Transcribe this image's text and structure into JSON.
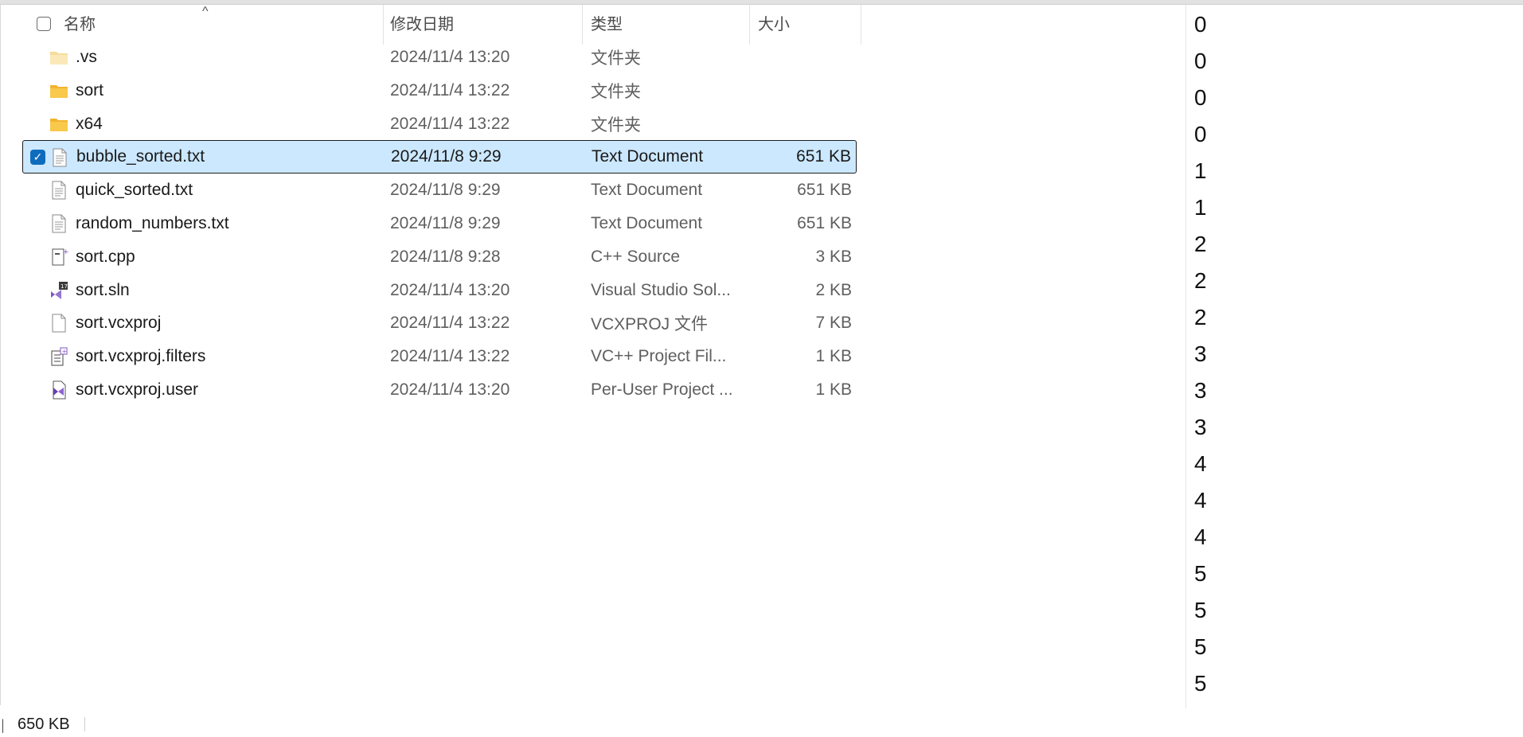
{
  "explorer": {
    "columns": {
      "name": "名称",
      "date": "修改日期",
      "type": "类型",
      "size": "大小"
    },
    "sort_indicator": "^",
    "rows": [
      {
        "name": ".vs",
        "date": "2024/11/4 13:20",
        "type": "文件夹",
        "size": "",
        "icon": "folder-light-icon",
        "selected": false
      },
      {
        "name": "sort",
        "date": "2024/11/4 13:22",
        "type": "文件夹",
        "size": "",
        "icon": "folder-icon",
        "selected": false
      },
      {
        "name": "x64",
        "date": "2024/11/4 13:22",
        "type": "文件夹",
        "size": "",
        "icon": "folder-icon",
        "selected": false
      },
      {
        "name": "bubble_sorted.txt",
        "date": "2024/11/8 9:29",
        "type": "Text Document",
        "size": "651 KB",
        "icon": "text-document-icon",
        "selected": true
      },
      {
        "name": "quick_sorted.txt",
        "date": "2024/11/8 9:29",
        "type": "Text Document",
        "size": "651 KB",
        "icon": "text-document-icon",
        "selected": false
      },
      {
        "name": "random_numbers.txt",
        "date": "2024/11/8 9:29",
        "type": "Text Document",
        "size": "651 KB",
        "icon": "text-document-icon",
        "selected": false
      },
      {
        "name": "sort.cpp",
        "date": "2024/11/8 9:28",
        "type": "C++ Source",
        "size": "3 KB",
        "icon": "cpp-source-icon",
        "selected": false
      },
      {
        "name": "sort.sln",
        "date": "2024/11/4 13:20",
        "type": "Visual Studio Sol...",
        "size": "2 KB",
        "icon": "visual-studio-solution-icon",
        "selected": false
      },
      {
        "name": "sort.vcxproj",
        "date": "2024/11/4 13:22",
        "type": "VCXPROJ 文件",
        "size": "7 KB",
        "icon": "blank-file-icon",
        "selected": false
      },
      {
        "name": "sort.vcxproj.filters",
        "date": "2024/11/4 13:22",
        "type": "VC++ Project Fil...",
        "size": "1 KB",
        "icon": "project-filters-icon",
        "selected": false
      },
      {
        "name": "sort.vcxproj.user",
        "date": "2024/11/4 13:20",
        "type": "Per-User Project ...",
        "size": "1 KB",
        "icon": "vs-user-file-icon",
        "selected": false
      }
    ]
  },
  "status_bar": {
    "fragment": "目",
    "size": "650 KB"
  },
  "text_pane": {
    "numbers": [
      "0",
      "0",
      "0",
      "0",
      "1",
      "1",
      "2",
      "2",
      "2",
      "3",
      "3",
      "3",
      "4",
      "4",
      "4",
      "5",
      "5",
      "5",
      "5"
    ]
  },
  "colors": {
    "selection_bg": "#cce8ff",
    "checkbox_blue": "#0f6cbd",
    "folder_yellow": "#f8c94a"
  }
}
